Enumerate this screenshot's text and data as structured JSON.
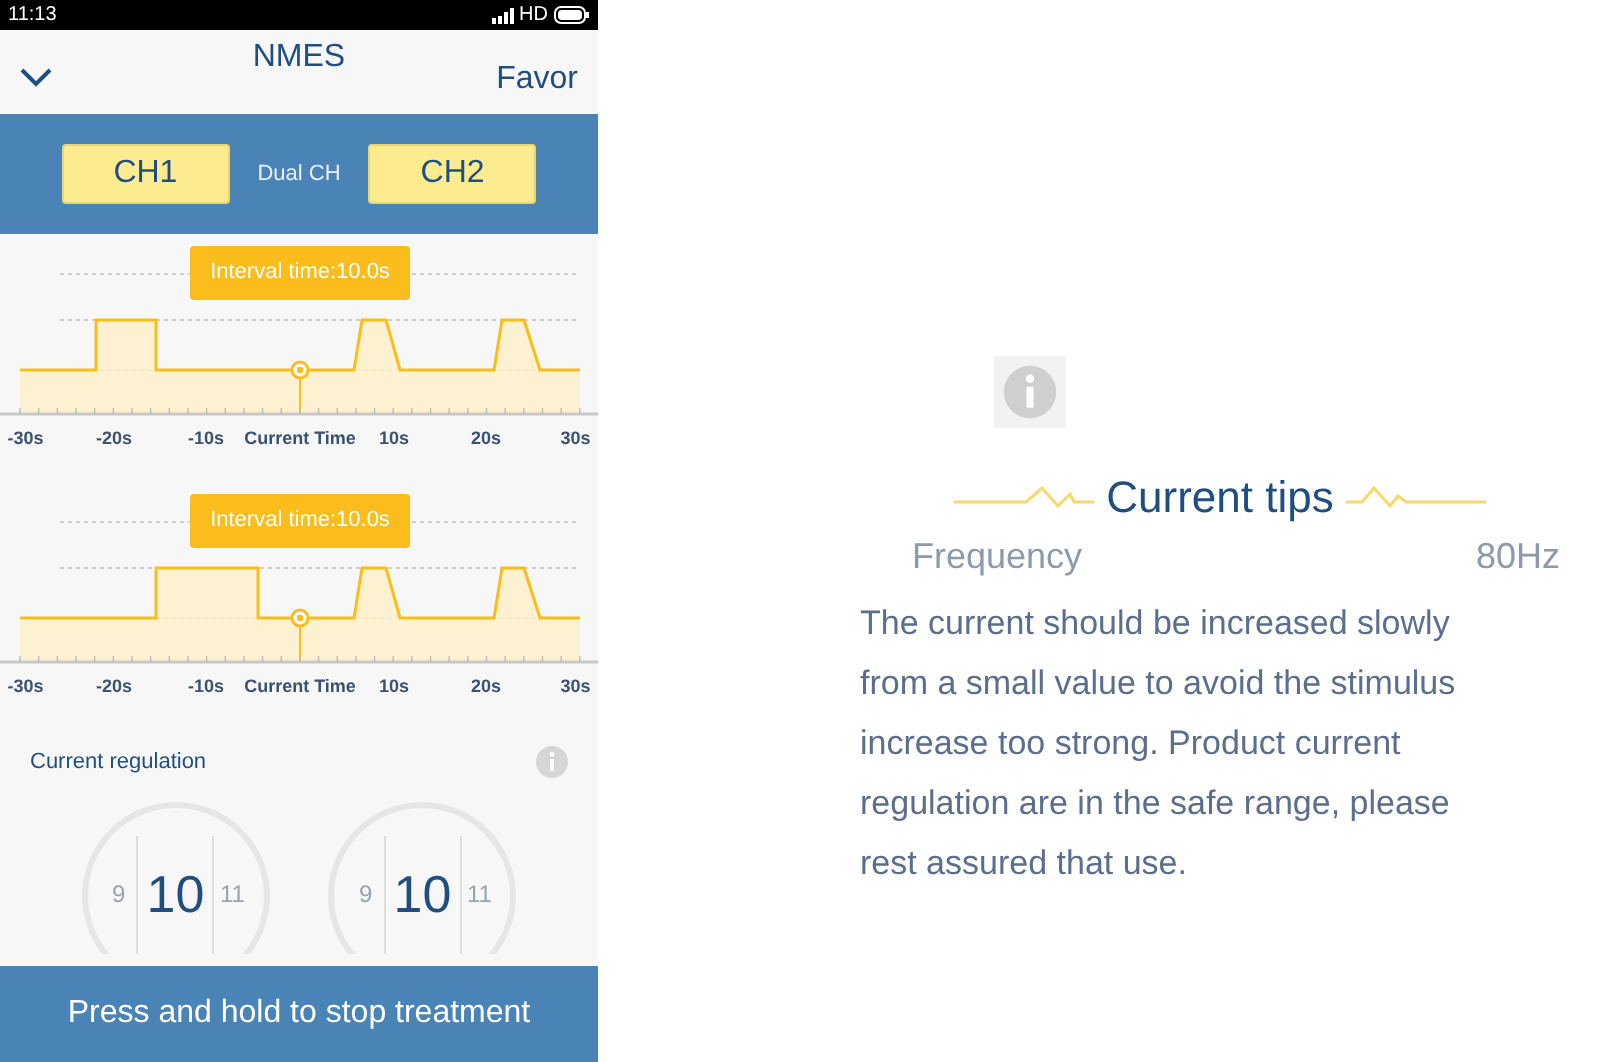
{
  "status_bar": {
    "time": "11:13",
    "network": "HD"
  },
  "header": {
    "title": "NMES",
    "action": "Favor"
  },
  "channel_bar": {
    "channels": [
      {
        "label": "CH1"
      },
      {
        "label": "CH2"
      }
    ],
    "mode": "Dual CH"
  },
  "timelines": [
    {
      "tooltip": "Interval time:10.0s",
      "axis_labels": [
        "-30s",
        "-20s",
        "-10s",
        "Current Time",
        "10s",
        "20s",
        "30s"
      ]
    },
    {
      "tooltip": "Interval time:10.0s",
      "axis_labels": [
        "-30s",
        "-20s",
        "-10s",
        "Current Time",
        "10s",
        "20s",
        "30s"
      ]
    }
  ],
  "regulation": {
    "title": "Current regulation",
    "dials": [
      {
        "prev": "9",
        "value": "10",
        "next": "11"
      },
      {
        "prev": "9",
        "value": "10",
        "next": "11"
      }
    ]
  },
  "stop_button": "Press and hold to stop treatment",
  "tips": {
    "title": "Current tips",
    "background_row": {
      "label": "Frequency",
      "value": "80Hz"
    },
    "text": "The current should be increased slowly from a small value to avoid the stimulus increase too strong. Product current regulation are in the safe range, please rest assured that use."
  }
}
